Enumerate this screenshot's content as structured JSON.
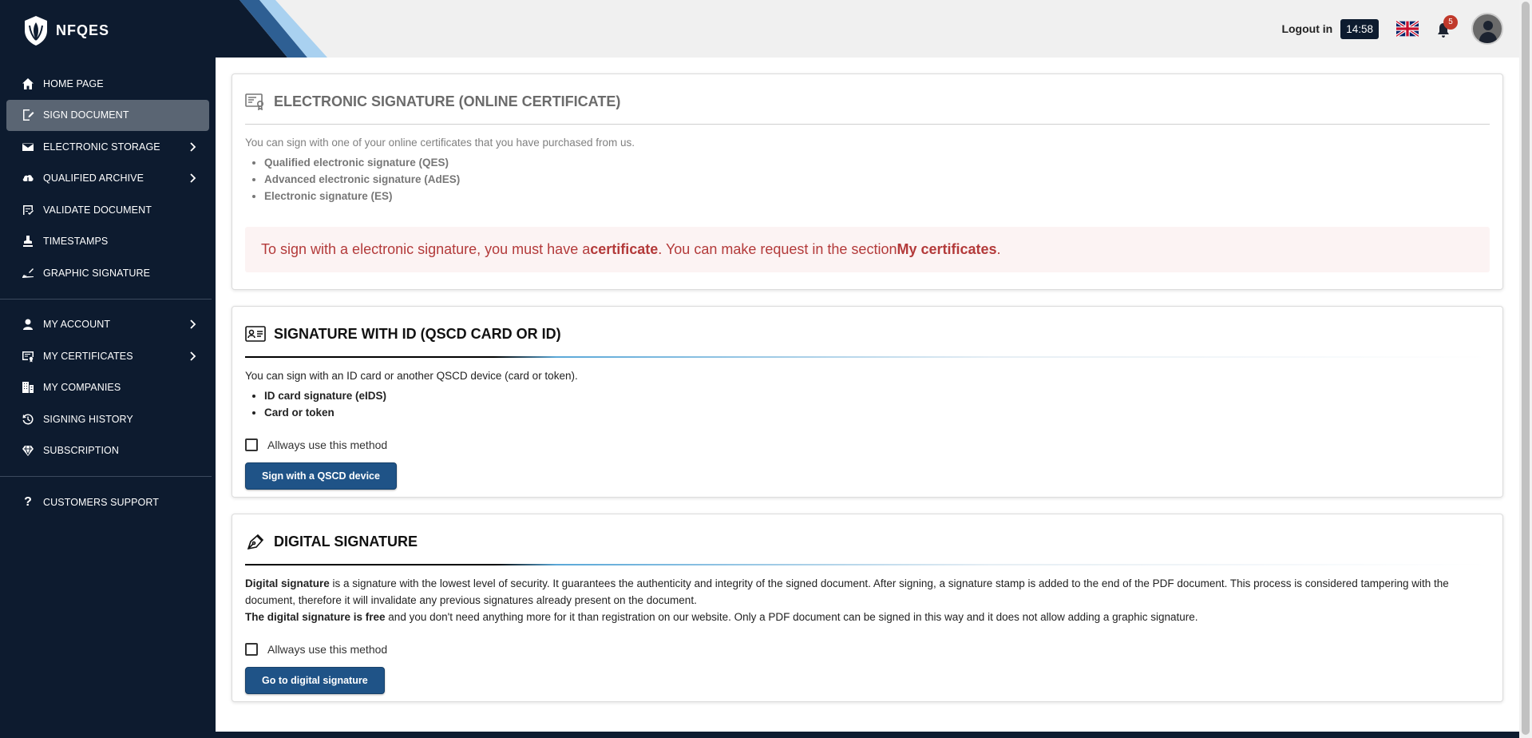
{
  "brand": {
    "name": "NFQES"
  },
  "sidebar": {
    "items": [
      {
        "label": "HOME PAGE",
        "icon": "home-icon",
        "active": false,
        "chevron": false
      },
      {
        "label": "SIGN DOCUMENT",
        "icon": "sign-document-icon",
        "active": true,
        "chevron": false
      },
      {
        "label": "ELECTRONIC STORAGE",
        "icon": "envelope-icon",
        "active": false,
        "chevron": true
      },
      {
        "label": "QUALIFIED ARCHIVE",
        "icon": "cloud-archive-icon",
        "active": false,
        "chevron": true
      },
      {
        "label": "VALIDATE DOCUMENT",
        "icon": "validate-icon",
        "active": false,
        "chevron": false
      },
      {
        "label": "TIMESTAMPS",
        "icon": "stamp-icon",
        "active": false,
        "chevron": false
      },
      {
        "label": "GRAPHIC SIGNATURE",
        "icon": "signature-pen-icon",
        "active": false,
        "chevron": false
      }
    ],
    "account_items": [
      {
        "label": "MY ACCOUNT",
        "icon": "user-icon",
        "chevron": true
      },
      {
        "label": "MY CERTIFICATES",
        "icon": "certificate-icon",
        "chevron": true
      },
      {
        "label": "MY COMPANIES",
        "icon": "building-icon",
        "chevron": false
      },
      {
        "label": "SIGNING HISTORY",
        "icon": "history-icon",
        "chevron": false
      },
      {
        "label": "SUBSCRIPTION",
        "icon": "diamond-icon",
        "chevron": false
      }
    ],
    "support_item": {
      "label": "CUSTOMERS SUPPORT",
      "icon": "question-icon"
    }
  },
  "topbar": {
    "logout_label": "Logout in",
    "timer": "14:58",
    "notifications_count": "5",
    "language_icon": "uk-flag-icon"
  },
  "cards": {
    "online_certificate": {
      "title": "ELECTRONIC SIGNATURE (ONLINE CERTIFICATE)",
      "intro": "You can sign with one of your online certificates that you have purchased from us.",
      "list": [
        "Qualified electronic signature (QES)",
        "Advanced electronic signature (AdES)",
        "Electronic signature (ES)"
      ],
      "alert": {
        "part1": "To sign with a electronic signature, you must have a ",
        "bold1": "certificate",
        "part2": ". You can make request in the section ",
        "bold2": "My certificates",
        "part3": "."
      }
    },
    "signature_id": {
      "title": "SIGNATURE WITH ID (QSCD CARD OR ID)",
      "intro": "You can sign with an ID card or another QSCD device (card or token).",
      "list": [
        "ID card signature (eIDS)",
        "Card or token"
      ],
      "checkbox_label": "Allways use this method",
      "button_label": "Sign with a QSCD device"
    },
    "digital": {
      "title": "DIGITAL SIGNATURE",
      "p1_bold": "Digital signature",
      "p1_rest": " is a signature with the lowest level of security. It guarantees the authenticity and integrity of the signed document. After signing, a signature stamp is added to the end of the PDF document. This process is considered tampering with the document, therefore it will invalidate any previous signatures already present on the document.",
      "p2_bold": "The digital signature is free",
      "p2_rest": " and you don't need anything more for it than registration on our website. Only a PDF document can be signed in this way and it does not allow adding a graphic signature.",
      "checkbox_label": "Allways use this method",
      "button_label": "Go to digital signature"
    }
  },
  "colors": {
    "sidebar_bg": "#0d1b2f",
    "accent_button": "#1f5387",
    "alert_text": "#b33a3a",
    "alert_bg": "#fcf3f3"
  }
}
